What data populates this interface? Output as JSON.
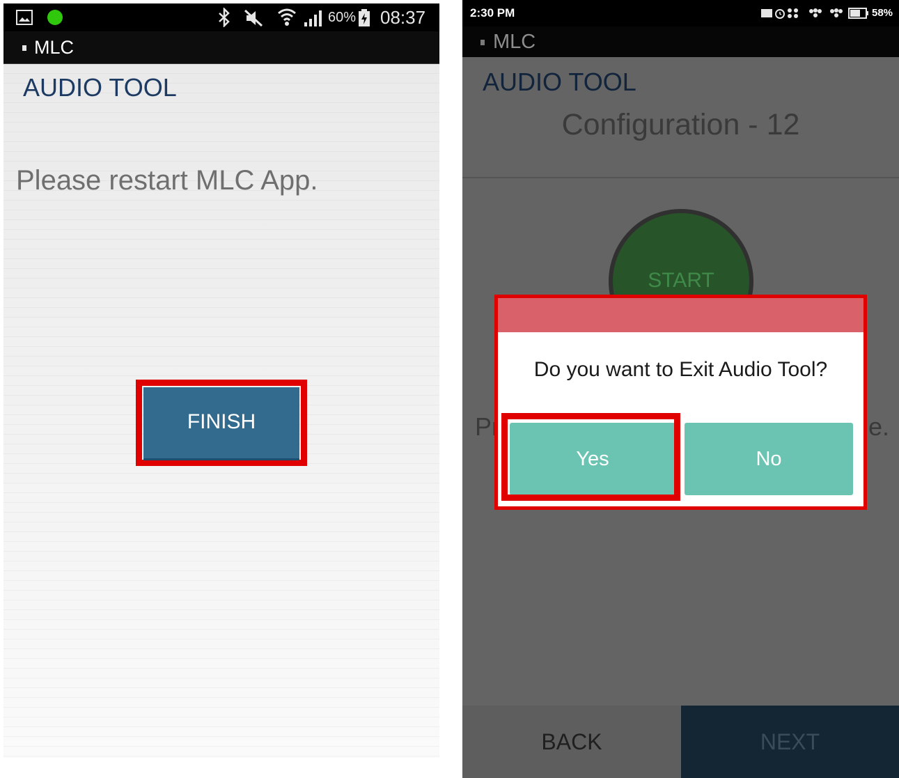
{
  "left_screen": {
    "status_bar": {
      "battery": "60%",
      "time": "08:37"
    },
    "app_bar": {
      "app_name": "MLC"
    },
    "title": "AUDIO TOOL",
    "message": "Please restart MLC App.",
    "finish_button": "FINISH"
  },
  "right_screen": {
    "status_bar": {
      "time": "2:30 PM",
      "battery": "58%"
    },
    "app_bar": {
      "app_name": "MLC"
    },
    "title": "AUDIO TOOL",
    "subtitle": "Configuration - 12",
    "start_button": "START",
    "obscured_text_left": "Pr",
    "obscured_text_right": "e.",
    "dialog": {
      "question": "Do you want to Exit Audio Tool?",
      "yes_label": "Yes",
      "no_label": "No"
    },
    "bottom_nav": {
      "back_label": "BACK",
      "next_label": "NEXT"
    }
  },
  "colors": {
    "highlight_outline": "#e00000",
    "finish_button_bg": "#336b8e",
    "dialog_button_bg": "#6ac4b1",
    "dialog_header_bg": "#d9626a",
    "next_bar_bg": "#142533"
  }
}
